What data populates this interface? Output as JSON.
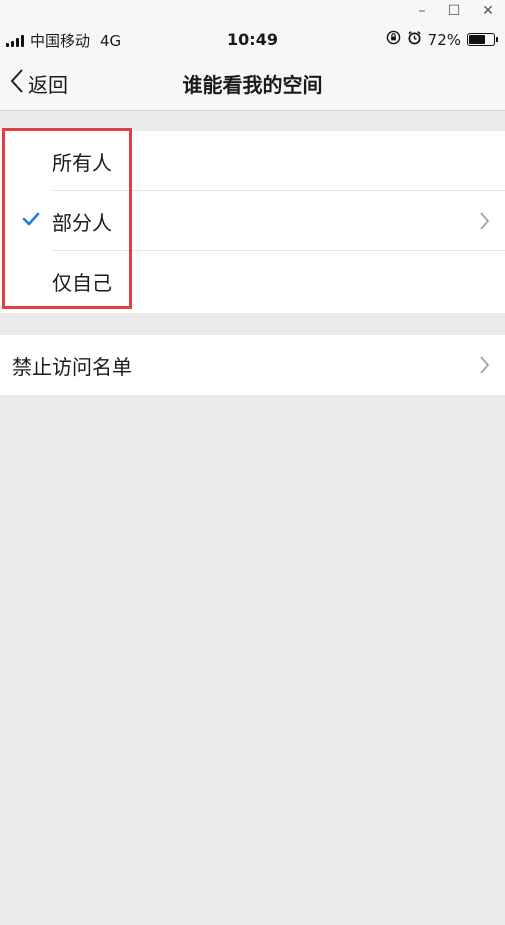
{
  "window": {
    "minimize": "–",
    "maximize": "☐",
    "close": "✕"
  },
  "status_bar": {
    "carrier": "中国移动",
    "network": "4G",
    "time": "10:49",
    "battery": "72%",
    "battery_level": 0.72
  },
  "nav": {
    "back_label": "返回",
    "title": "谁能看我的空间"
  },
  "visibility_options": [
    {
      "label": "所有人"
    },
    {
      "label": "部分人"
    },
    {
      "label": "仅自己"
    }
  ],
  "block_list": {
    "label": "禁止访问名单"
  },
  "icons": {
    "back": "chevron-left-icon",
    "selected": "checkmark-icon",
    "disclosure": "chevron-right-icon"
  },
  "colors": {
    "accent": "#1f7ce0",
    "highlight": "#e0403f",
    "background": "#ebebeb"
  }
}
